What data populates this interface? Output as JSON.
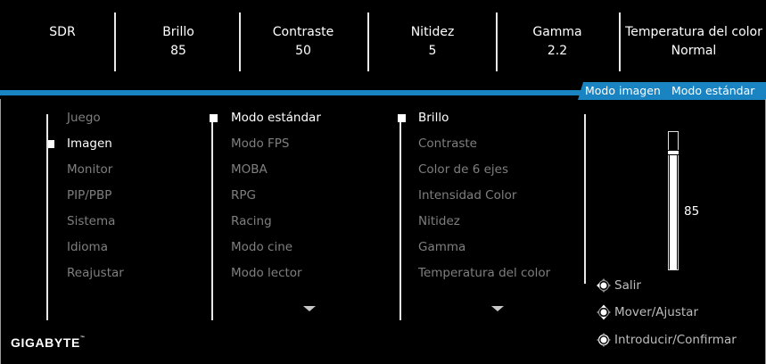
{
  "status_bar": [
    {
      "label": "SDR",
      "value": ""
    },
    {
      "label": "Brillo",
      "value": "85"
    },
    {
      "label": "Contraste",
      "value": "50"
    },
    {
      "label": "Nitidez",
      "value": "5"
    },
    {
      "label": "Gamma",
      "value": "2.2"
    },
    {
      "label": "Temperatura del color",
      "value": "Normal"
    }
  ],
  "banner": {
    "section": "Modo imagen",
    "value": "Modo estándar"
  },
  "main_menu": [
    "Juego",
    "Imagen",
    "Monitor",
    "PIP/PBP",
    "Sistema",
    "Idioma",
    "Reajustar"
  ],
  "main_menu_selected": "Imagen",
  "picture_modes": [
    "Modo estándar",
    "Modo FPS",
    "MOBA",
    "RPG",
    "Racing",
    "Modo cine",
    "Modo lector"
  ],
  "picture_mode_selected": "Modo estándar",
  "settings": [
    "Brillo",
    "Contraste",
    "Color de 6 ejes",
    "Intensidad Color",
    "Nitidez",
    "Gamma",
    "Temperatura del color"
  ],
  "setting_selected": "Brillo",
  "slider": {
    "value": "85",
    "level": 0.85
  },
  "hints": {
    "exit": "Salir",
    "move": "Mover/Ajustar",
    "enter": "Introducir/Confirmar"
  },
  "logo": "GIGABYTE",
  "colors": {
    "accent": "#1a83c2",
    "selected": "#ffffff",
    "inactive": "#7f7f7f",
    "background": "#000000"
  }
}
